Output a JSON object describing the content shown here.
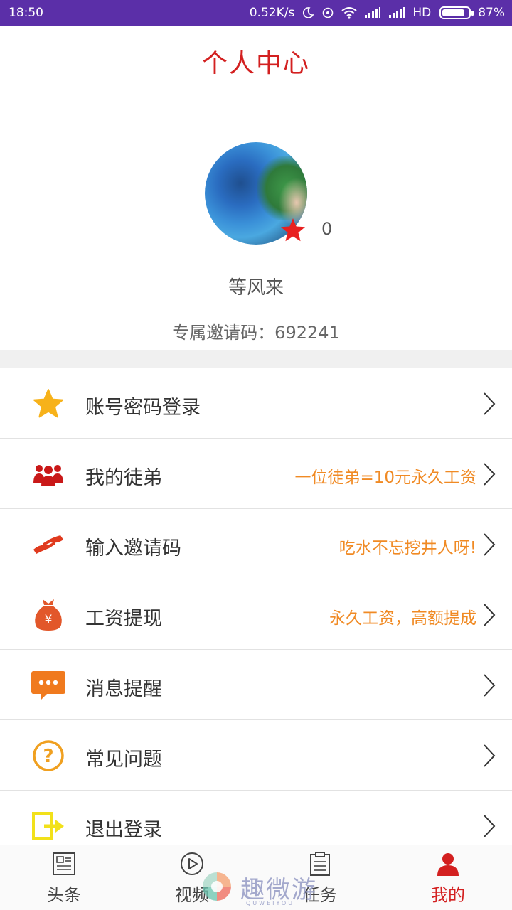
{
  "status_bar": {
    "time": "18:50",
    "net_speed": "0.52K/s",
    "network": "HD",
    "battery_pct": "87%",
    "battery_level": 0.87
  },
  "header": {
    "title": "个人中心"
  },
  "profile": {
    "star_count": "0",
    "nickname": "等风来",
    "invite_code": "专属邀请码：692241"
  },
  "menu": {
    "items": [
      {
        "label": "账号密码登录",
        "hint": "",
        "icon": "star-icon"
      },
      {
        "label": "我的徒弟",
        "hint": "一位徒弟=10元永久工资",
        "icon": "people-icon"
      },
      {
        "label": "输入邀请码",
        "hint": "吃水不忘挖井人呀!",
        "icon": "handshake-icon"
      },
      {
        "label": "工资提现",
        "hint": "永久工资，高额提成",
        "icon": "money-bag-icon"
      },
      {
        "label": "消息提醒",
        "hint": "",
        "icon": "message-icon"
      },
      {
        "label": "常见问题",
        "hint": "",
        "icon": "question-icon"
      },
      {
        "label": "退出登录",
        "hint": "",
        "icon": "logout-icon"
      }
    ]
  },
  "bottom_nav": {
    "tabs": [
      {
        "label": "头条",
        "icon": "news-icon"
      },
      {
        "label": "视频",
        "icon": "play-icon"
      },
      {
        "label": "任务",
        "icon": "clipboard-icon"
      },
      {
        "label": "我的",
        "icon": "user-icon",
        "active": true
      }
    ]
  },
  "watermark": {
    "text": "趣微游",
    "sub": "QUWEIYOU"
  },
  "colors": {
    "accent_red": "#d32020",
    "hint_orange": "#f08a24",
    "status_bar": "#5b2fa8"
  }
}
